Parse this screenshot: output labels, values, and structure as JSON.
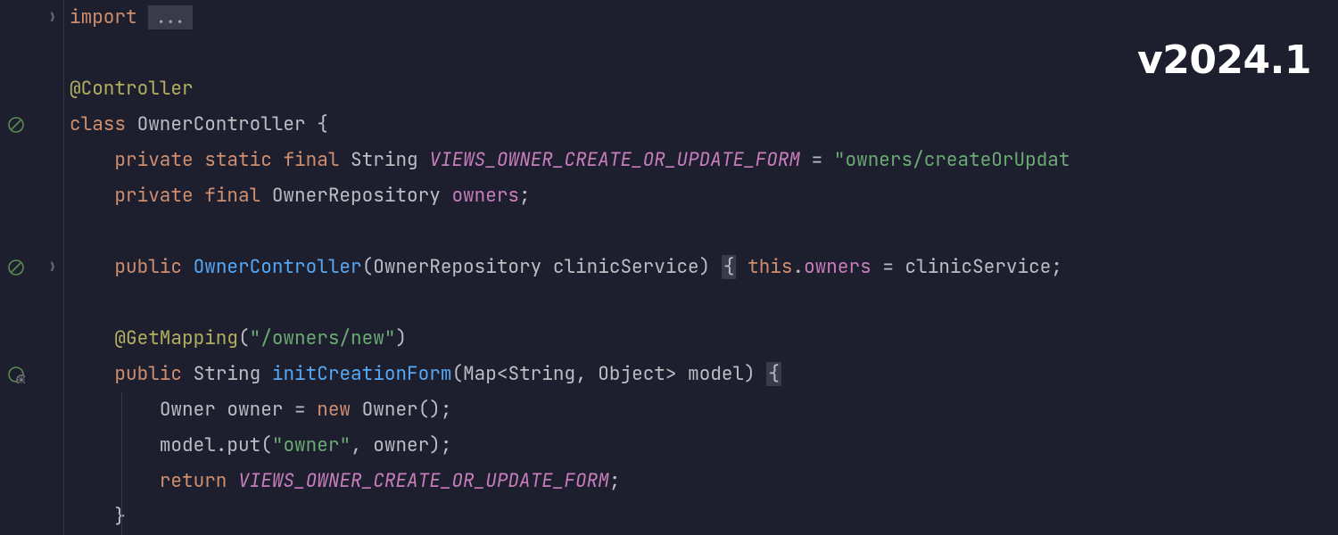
{
  "version_label": "v2024.1",
  "fold_dots": "...",
  "kw": {
    "import": "import",
    "class": "class",
    "private": "private",
    "static": "static",
    "final": "final",
    "public": "public",
    "new": "new",
    "return": "return",
    "this": "this"
  },
  "annotations": {
    "controller": "@Controller",
    "getmapping": "@GetMapping"
  },
  "identifiers": {
    "class_name": "OwnerController",
    "string_type": "String",
    "const_name": "VIEWS_OWNER_CREATE_OR_UPDATE_FORM",
    "owner_repo": "OwnerRepository",
    "owners_field": "owners",
    "clinic_service": "clinicService",
    "init_form": "initCreationForm",
    "map_type": "Map",
    "object_type": "Object",
    "model_param": "model",
    "owner_type": "Owner",
    "owner_var": "owner",
    "put_method": "put"
  },
  "strings": {
    "form_path": "\"owners/createOrUpdat",
    "owners_new": "\"/owners/new\"",
    "owner_key": "\"owner\""
  },
  "punct": {
    "open_brace": "{",
    "close_brace": "}",
    "open_paren": "(",
    "close_paren": ")",
    "semicolon": ";",
    "equals": " = ",
    "dot": ".",
    "comma": ", ",
    "lt": "<",
    "gt": ">"
  }
}
